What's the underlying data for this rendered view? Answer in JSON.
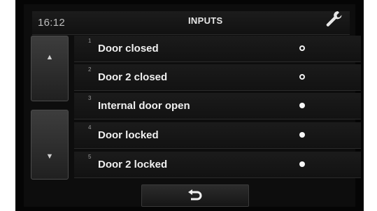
{
  "header": {
    "time": "16:12",
    "title": "INPUTS",
    "settings_icon": "wrench-icon"
  },
  "navigation": {
    "up_icon": "triangle-up-icon",
    "down_icon": "triangle-down-icon",
    "back_icon": "return-arrow-icon"
  },
  "inputs": [
    {
      "number": "1",
      "label": "Door closed",
      "active": false
    },
    {
      "number": "2",
      "label": "Door 2 closed",
      "active": false
    },
    {
      "number": "3",
      "label": "Internal door open",
      "active": true
    },
    {
      "number": "4",
      "label": "Door locked",
      "active": true
    },
    {
      "number": "5",
      "label": "Door 2 locked",
      "active": true
    }
  ],
  "colors": {
    "background": "#0d0d0d",
    "text": "#f0f0f0",
    "indicator": "#f7f7f7"
  }
}
